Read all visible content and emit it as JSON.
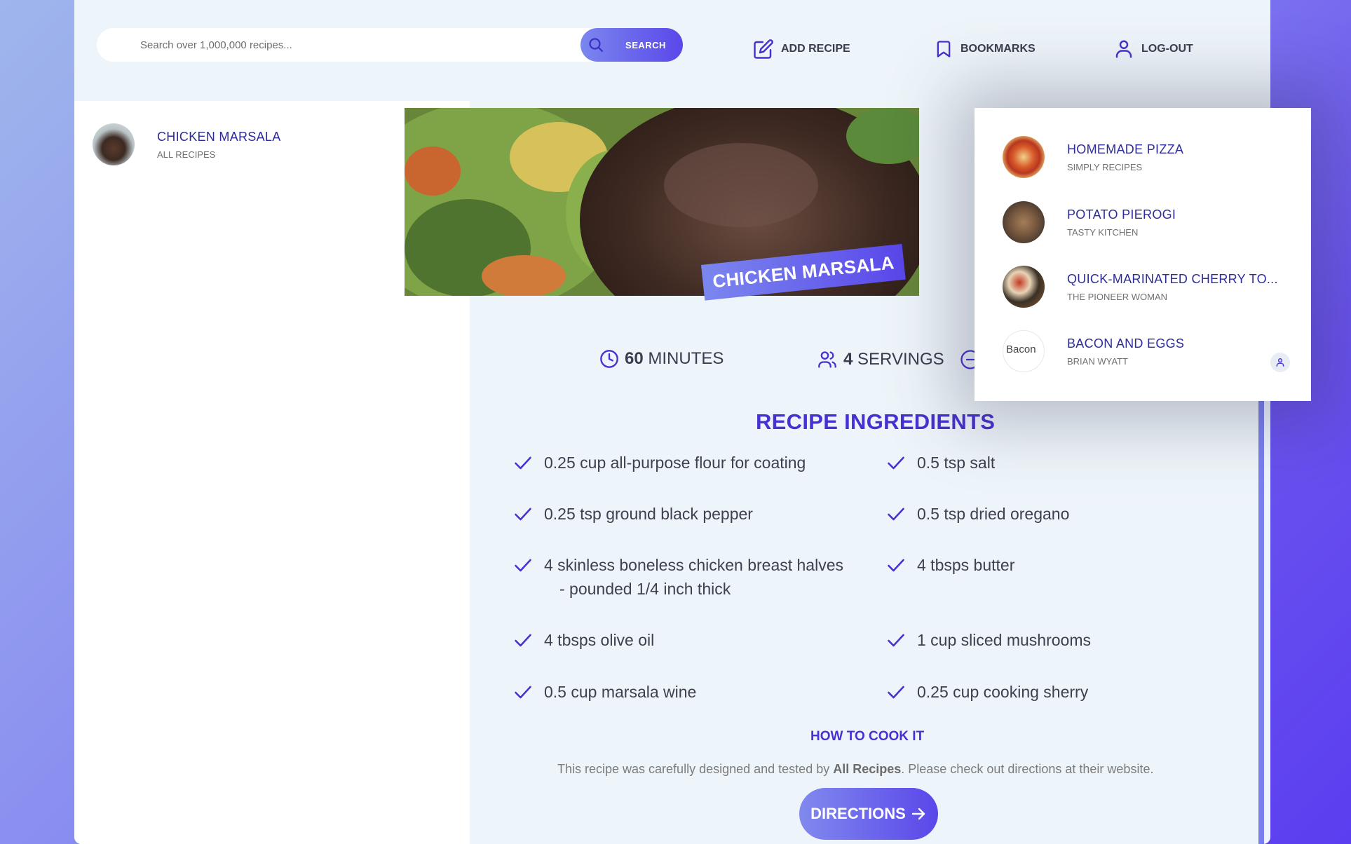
{
  "search": {
    "placeholder": "Search over 1,000,000 recipes...",
    "button_label": "SEARCH"
  },
  "nav": {
    "add_recipe": "ADD RECIPE",
    "bookmarks": "BOOKMARKS",
    "logout": "LOG-OUT"
  },
  "results": [
    {
      "title": "CHICKEN MARSALA",
      "publisher": "ALL RECIPES"
    }
  ],
  "recipe": {
    "title": "CHICKEN MARSALA",
    "minutes": "60",
    "minutes_label": "MINUTES",
    "servings": "4",
    "servings_label": "SERVINGS",
    "ingredients_heading": "RECIPE INGREDIENTS",
    "ingredients": [
      {
        "line1": "0.25 cup all-purpose flour for coating",
        "line2": ""
      },
      {
        "line1": "0.5 tsp salt",
        "line2": ""
      },
      {
        "line1": "0.25 tsp ground black pepper",
        "line2": ""
      },
      {
        "line1": "0.5 tsp dried oregano",
        "line2": ""
      },
      {
        "line1": "4 skinless boneless chicken breast halves",
        "line2": "- pounded 1/4 inch thick"
      },
      {
        "line1": "4 tbsps butter",
        "line2": ""
      },
      {
        "line1": "4 tbsps olive oil",
        "line2": ""
      },
      {
        "line1": "1 cup sliced mushrooms",
        "line2": ""
      },
      {
        "line1": "0.5 cup marsala wine",
        "line2": ""
      },
      {
        "line1": "0.25 cup cooking sherry",
        "line2": ""
      }
    ],
    "cook_heading": "HOW TO COOK IT",
    "cook_text_pre": "This recipe was carefully designed and tested by ",
    "cook_publisher": "All Recipes",
    "cook_text_post": ". Please check out directions at their website.",
    "directions_label": "DIRECTIONS"
  },
  "bookmarks": [
    {
      "title": "HOMEMADE PIZZA",
      "publisher": "SIMPLY RECIPES"
    },
    {
      "title": "POTATO PIEROGI",
      "publisher": "TASTY KITCHEN"
    },
    {
      "title": "QUICK-MARINATED CHERRY TO...",
      "publisher": "THE PIONEER WOMAN"
    },
    {
      "title": "BACON AND EGGS",
      "publisher": "BRIAN WYATT",
      "img_alt": "Bacon"
    }
  ],
  "colors": {
    "accent": "#4632d2",
    "title_blue": "#2e2c98",
    "gradient_start": "#7b87ee",
    "gradient_end": "#5a47ea"
  }
}
